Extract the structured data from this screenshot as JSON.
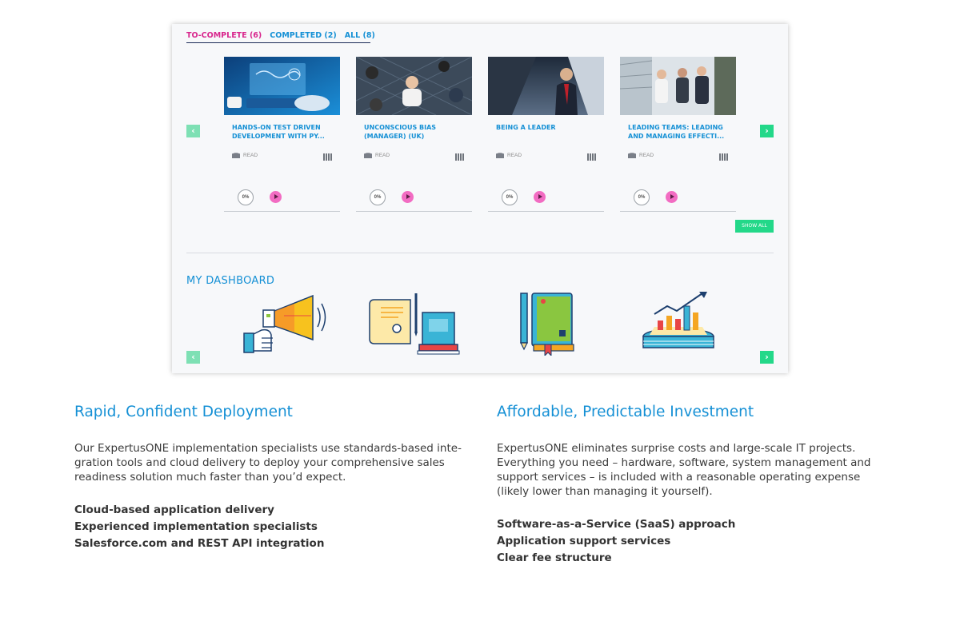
{
  "tabs": [
    {
      "label": "TO-COMPLETE (6)",
      "active": true
    },
    {
      "label": "COMPLETED (2)",
      "active": false
    },
    {
      "label": "ALL (8)",
      "active": false
    }
  ],
  "cards": [
    {
      "title": "HANDS-ON TEST DRIVEN DEVELOPMENT WITH PY...",
      "type": "READ",
      "progress": "0%"
    },
    {
      "title": "UNCONSCIOUS BIAS (MANAGER) (UK)",
      "type": "READ",
      "progress": "0%"
    },
    {
      "title": "BEING A LEADER",
      "type": "READ",
      "progress": "0%"
    },
    {
      "title": "LEADING TEAMS: LEADING AND MANAGING EFFECTI...",
      "type": "READ",
      "progress": "0%"
    }
  ],
  "show_all_label": "SHOW ALL",
  "dashboard": {
    "title": "MY DASHBOARD",
    "icons": [
      "megaphone-icon",
      "certificate-icon",
      "notebook-icon",
      "growth-chart-icon"
    ]
  },
  "nav": {
    "prev": "‹",
    "next": "›"
  },
  "sections": [
    {
      "title": "Rapid, Confident Deployment",
      "body": "Our ExpertusONE implementation specialists use standards-based inte-gration tools and cloud delivery to deploy your comprehensive sales readiness solution much faster than you’d expect.",
      "bullets": [
        "Cloud-based application delivery",
        "Experienced implementation specialists",
        "Salesforce.com and REST API integration"
      ]
    },
    {
      "title": "Affordable, Predictable Investment",
      "body": "ExpertusONE eliminates surprise costs and large-scale IT projects. Everything you need – hardware, software, system management and support services – is included with a reasonable operating expense (likely lower than managing it yourself).",
      "bullets": [
        "Software-as-a-Service (SaaS) approach",
        "Application support services",
        "Clear fee structure"
      ]
    }
  ],
  "colors": {
    "accent": "#1590d5",
    "active_tab": "#d8268d",
    "green": "#23d889",
    "play": "#f26cc2"
  }
}
